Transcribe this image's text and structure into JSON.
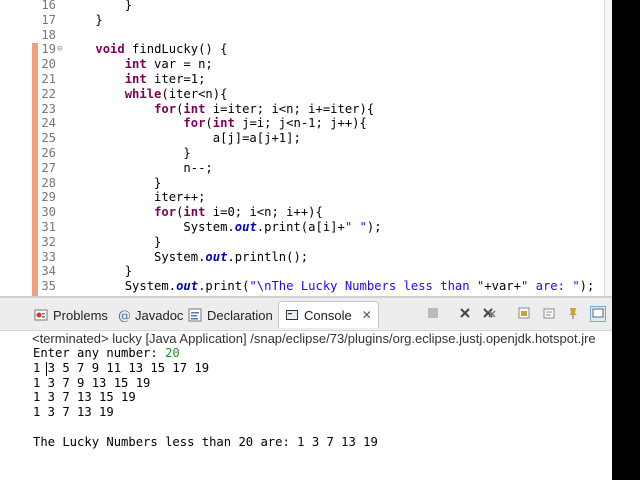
{
  "editor": {
    "lines": [
      {
        "n": "16",
        "t": [
          {
            "c": "        }"
          }
        ]
      },
      {
        "n": "17",
        "t": [
          {
            "c": "    }"
          }
        ]
      },
      {
        "n": "18",
        "t": [
          {
            "c": ""
          }
        ]
      },
      {
        "n": "19",
        "fold": true,
        "t": [
          {
            "c": "    "
          },
          {
            "k": "void"
          },
          {
            "c": " findLucky() {"
          }
        ]
      },
      {
        "n": "20",
        "t": [
          {
            "c": "        "
          },
          {
            "k": "int"
          },
          {
            "c": " var = n;"
          }
        ]
      },
      {
        "n": "21",
        "t": [
          {
            "c": "        "
          },
          {
            "k": "int"
          },
          {
            "c": " iter=1;"
          }
        ]
      },
      {
        "n": "22",
        "t": [
          {
            "c": "        "
          },
          {
            "k": "while"
          },
          {
            "c": "(iter<n){"
          }
        ]
      },
      {
        "n": "23",
        "t": [
          {
            "c": "            "
          },
          {
            "k": "for"
          },
          {
            "c": "("
          },
          {
            "k": "int"
          },
          {
            "c": " i=iter; i<n; i+=iter){"
          }
        ]
      },
      {
        "n": "24",
        "t": [
          {
            "c": "                "
          },
          {
            "k": "for"
          },
          {
            "c": "("
          },
          {
            "k": "int"
          },
          {
            "c": " j=i; j<n-1; j++){"
          }
        ]
      },
      {
        "n": "25",
        "t": [
          {
            "c": "                    a[j]=a[j+1];"
          }
        ]
      },
      {
        "n": "26",
        "t": [
          {
            "c": "                }"
          }
        ]
      },
      {
        "n": "27",
        "t": [
          {
            "c": "                n--;"
          }
        ]
      },
      {
        "n": "28",
        "t": [
          {
            "c": "            }"
          }
        ]
      },
      {
        "n": "29",
        "t": [
          {
            "c": "            iter++;"
          }
        ]
      },
      {
        "n": "30",
        "t": [
          {
            "c": "            "
          },
          {
            "k": "for"
          },
          {
            "c": "("
          },
          {
            "k": "int"
          },
          {
            "c": " i=0; i<n; i++){"
          }
        ]
      },
      {
        "n": "31",
        "t": [
          {
            "c": "                System."
          },
          {
            "s": "out"
          },
          {
            "c": ".print(a[i]+"
          },
          {
            "q": "\" \""
          },
          {
            "c": ");"
          }
        ]
      },
      {
        "n": "32",
        "t": [
          {
            "c": "            }"
          }
        ]
      },
      {
        "n": "33",
        "t": [
          {
            "c": "            System."
          },
          {
            "s": "out"
          },
          {
            "c": ".println();"
          }
        ]
      },
      {
        "n": "34",
        "t": [
          {
            "c": "        }"
          }
        ]
      },
      {
        "n": "35",
        "t": [
          {
            "c": "        System."
          },
          {
            "s": "out"
          },
          {
            "c": ".print("
          },
          {
            "q": "\"\\nThe Lucky Numbers less than \""
          },
          {
            "c": "+var+"
          },
          {
            "q": "\" are: \""
          },
          {
            "c": ");"
          }
        ]
      }
    ]
  },
  "tabs": {
    "problems": "Problems",
    "javadoc": "Javadoc",
    "declaration": "Declaration",
    "console": "Console"
  },
  "console": {
    "terminated": "<terminated> lucky [Java Application] /snap/eclipse/73/plugins/org.eclipse.justj.openjdk.hotspot.jre",
    "prompt": "Enter any number: ",
    "input_value": "20",
    "outputs": [
      "1 3 5 7 9 11 13 15 17 19",
      "1 3 7 9 13 15 19",
      "1 3 7 13 15 19",
      "1 3 7 13 19",
      "",
      "The Lucky Numbers less than 20 are: 1 3 7 13 19"
    ]
  },
  "colors": {
    "keyword": "#7f0055",
    "string": "#2a00ff",
    "static_field": "#0000c0",
    "user_input": "#2e8b2e"
  }
}
